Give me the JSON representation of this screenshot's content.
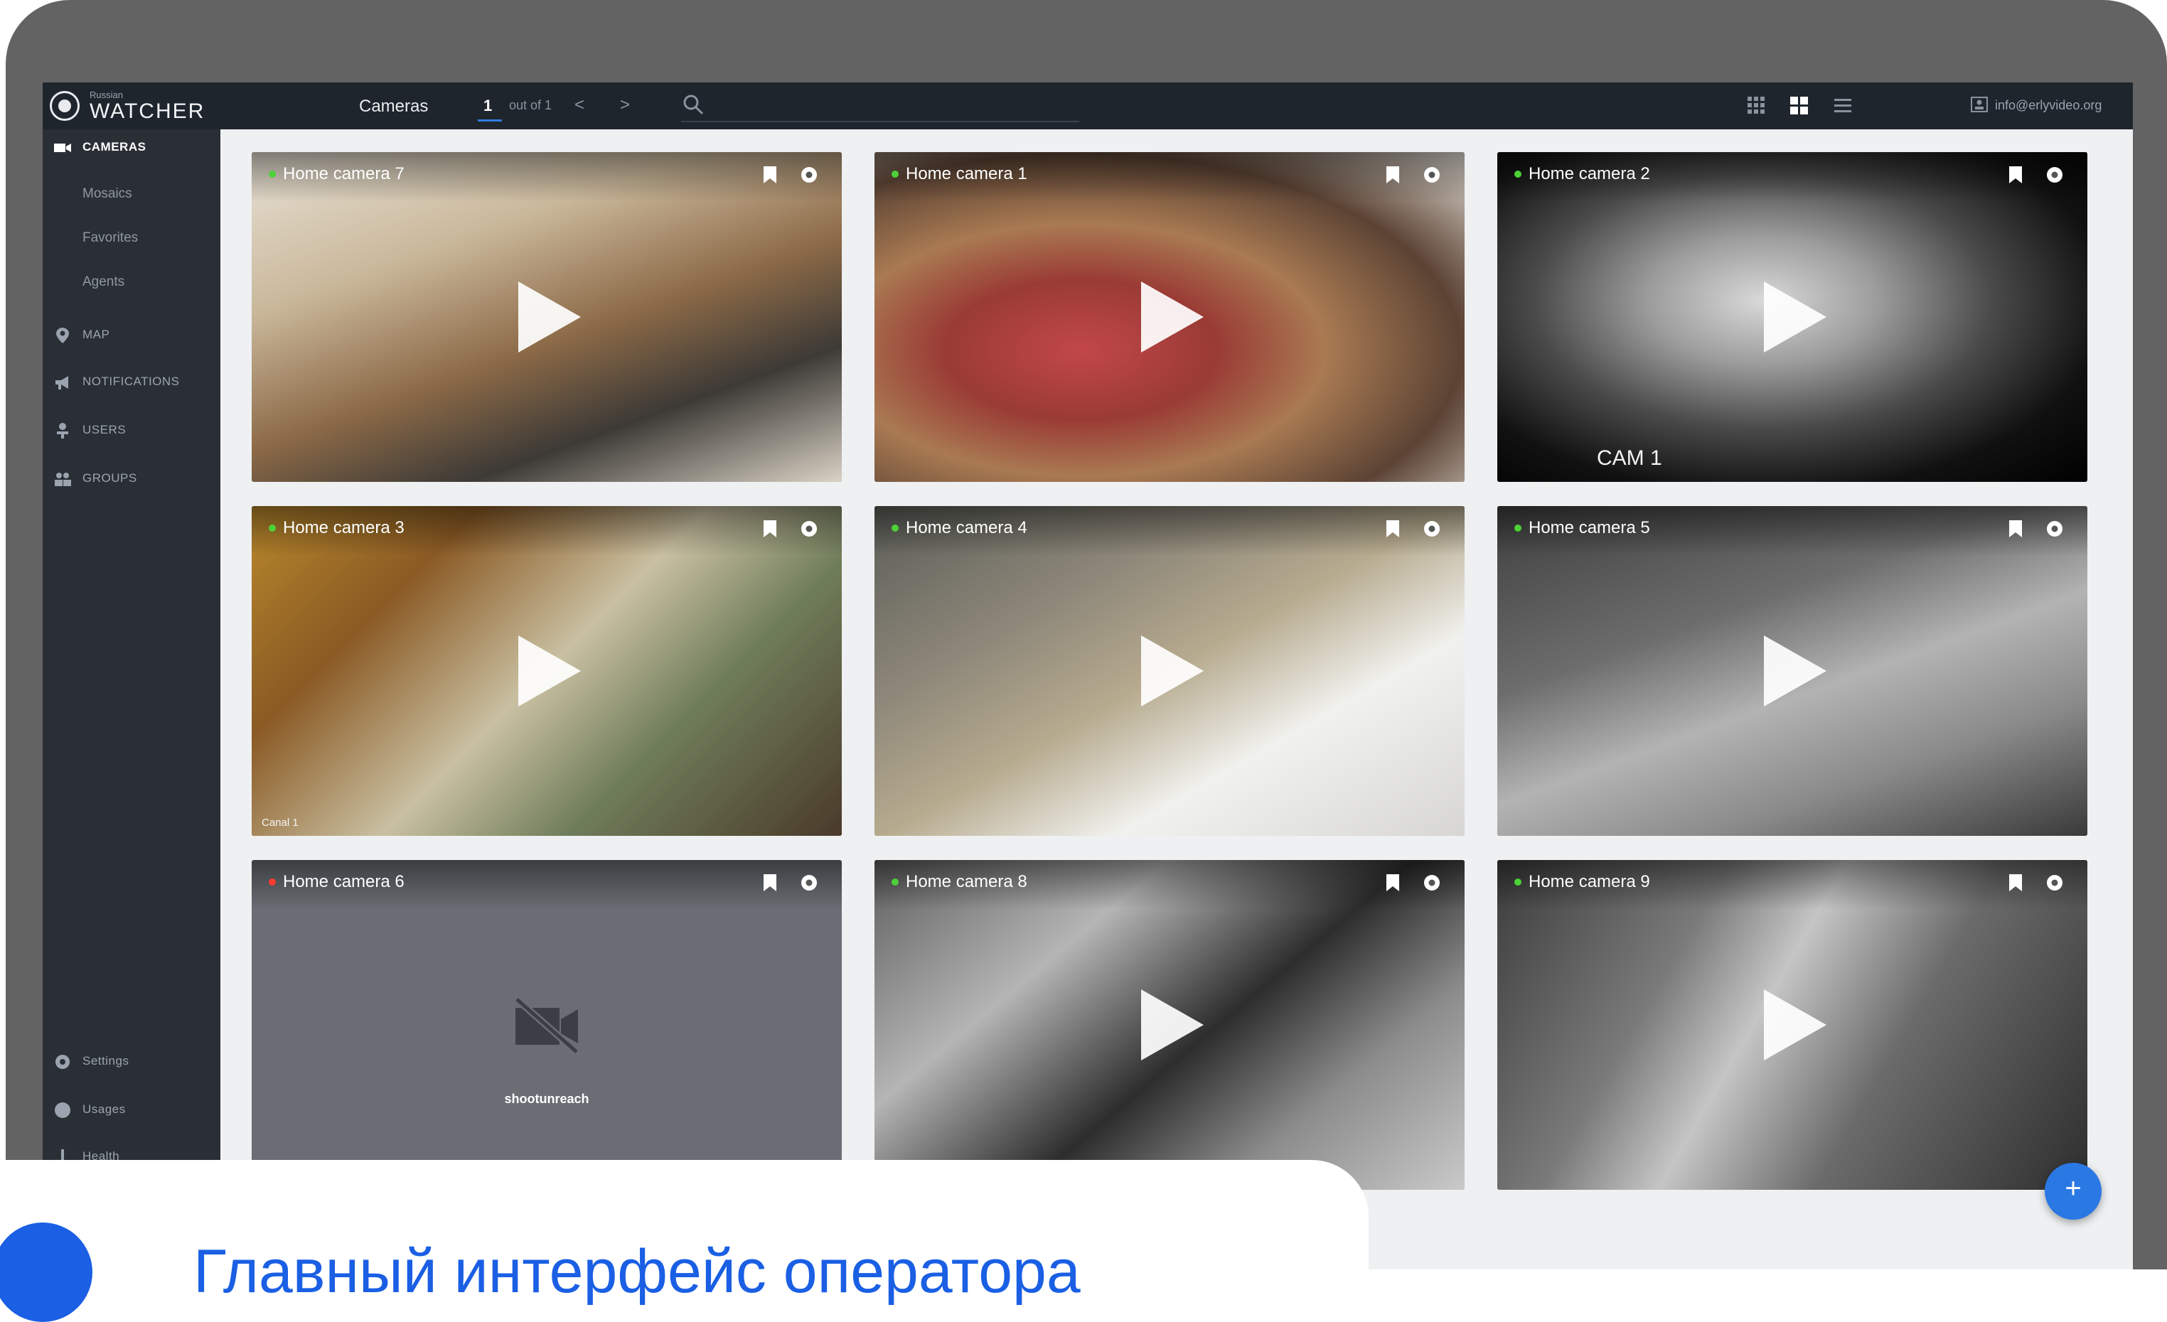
{
  "app": {
    "logo_small": "Russian",
    "logo_name": "WATCHER",
    "logo_icon": "watcher-logo-icon"
  },
  "topbar": {
    "section_title": "Cameras",
    "page_current": "1",
    "page_of": "out of 1",
    "prev_label": "<",
    "next_label": ">",
    "search_placeholder": "",
    "view_icons": [
      "grid-small-icon",
      "grid-large-icon",
      "list-view-icon"
    ],
    "user_email": "info@erlyvideo.org"
  },
  "sidebar": {
    "items": [
      {
        "label": "CAMERAS",
        "icon": "video-camera-icon",
        "active": true
      },
      {
        "label": "MAP",
        "icon": "map-pin-icon"
      },
      {
        "label": "NOTIFICATIONS",
        "icon": "megaphone-icon"
      },
      {
        "label": "USERS",
        "icon": "user-icon"
      },
      {
        "label": "GROUPS",
        "icon": "group-icon"
      }
    ],
    "sub_items": [
      "Mosaics",
      "Favorites",
      "Agents"
    ],
    "bottom_items": [
      {
        "label": "Settings",
        "icon": "gear-icon"
      },
      {
        "label": "Usages",
        "icon": "pie-chart-icon"
      },
      {
        "label": "Health",
        "icon": "thermometer-icon"
      }
    ]
  },
  "cameras": [
    {
      "title": "Home camera 7",
      "status": "online",
      "overlay": "",
      "scene": "kitchen"
    },
    {
      "title": "Home camera 1",
      "status": "online",
      "overlay": "",
      "scene": "dining"
    },
    {
      "title": "Home camera 2",
      "status": "online",
      "overlay": "CAM 1",
      "scene": "night"
    },
    {
      "title": "Home camera 3",
      "status": "online",
      "overlay": "Canal 1",
      "scene": "family"
    },
    {
      "title": "Home camera 4",
      "status": "online",
      "overlay": "",
      "scene": "office"
    },
    {
      "title": "Home camera 5",
      "status": "online",
      "overlay": "",
      "scene": "gray-office"
    },
    {
      "title": "Home camera 6",
      "status": "offline",
      "overlay": "",
      "scene": "offline",
      "offline_text": "shootunreach"
    },
    {
      "title": "Home camera 8",
      "status": "online",
      "overlay": "",
      "scene": "bw-shop"
    },
    {
      "title": "Home camera 9",
      "status": "online",
      "overlay": "",
      "scene": "stairs"
    }
  ],
  "fab": {
    "label": "+"
  },
  "caption": {
    "text": "Главный интерфейс оператора"
  },
  "colors": {
    "online": "#4cd137",
    "offline": "#ff3b30",
    "accent": "#1a5fe4",
    "topbar": "#1f252d",
    "sidebar": "#2a2f36"
  }
}
